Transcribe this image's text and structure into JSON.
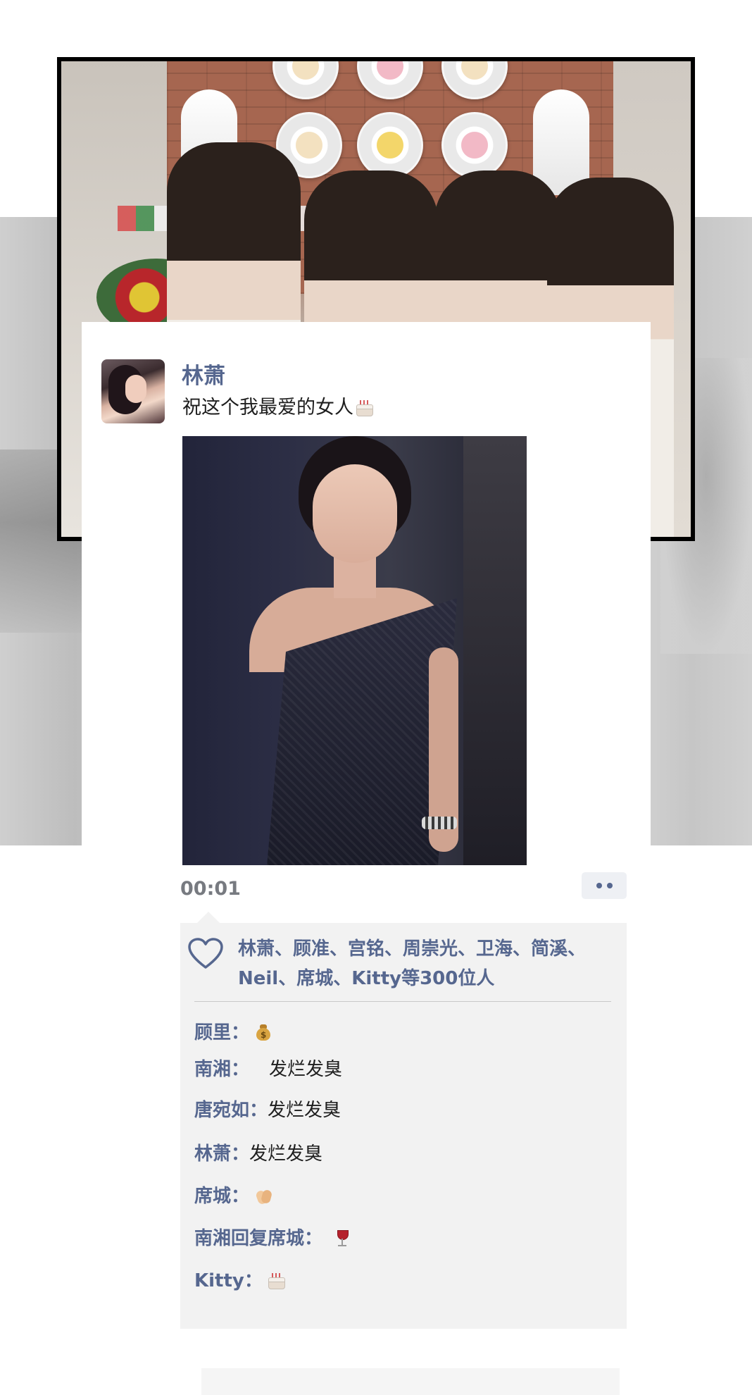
{
  "post": {
    "author": "林萧",
    "text": "祝这个我最爱的女人",
    "text_emoji": "birthday-cake",
    "video_time": "00:01"
  },
  "likes": {
    "text": "林萧、顾准、宫铭、周崇光、卫海、简溪、Neil、席城、Kitty等300位人"
  },
  "comments": [
    {
      "author": "顾里：",
      "text": "",
      "emoji": "money-bag"
    },
    {
      "author": "南湘：",
      "text": "发烂发臭",
      "emoji": ""
    },
    {
      "author": "唐宛如：",
      "text": "发烂发臭",
      "emoji": ""
    },
    {
      "author": "林萧：",
      "text": "发烂发臭",
      "emoji": ""
    },
    {
      "author": "席城：",
      "text": "",
      "emoji": "clapping-hands"
    },
    {
      "author": "南湘回复席城：",
      "text": "",
      "emoji": "wine-glass"
    },
    {
      "author": "Kitty：",
      "text": "",
      "emoji": "birthday-cake"
    }
  ],
  "colors": {
    "name_blue": "#56678f",
    "panel_bg": "#f2f2f2",
    "time_grey": "#777a80"
  }
}
